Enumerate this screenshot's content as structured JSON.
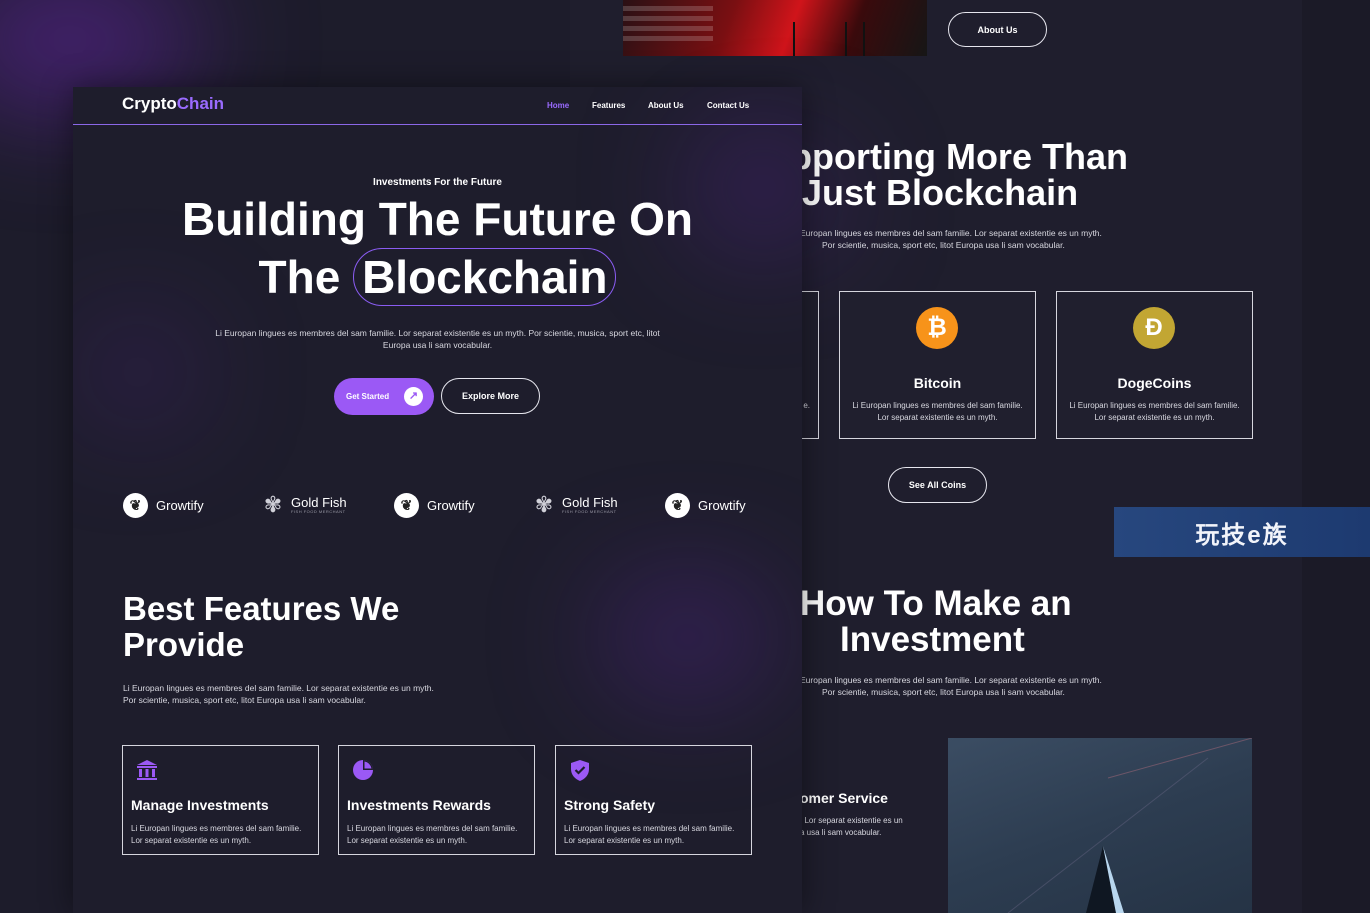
{
  "colors": {
    "accent": "#9b59f5",
    "background": "#1e1d2c",
    "bitcoin": "#f7931a",
    "dogecoin": "#c2a633"
  },
  "right_page": {
    "about_button": "About Us",
    "supporting": {
      "title_line1": "pporting More Than",
      "title_line2": "Just Blockchain",
      "para_line1": "Europan lingues es membres del sam familie. Lor separat existentie es un myth.",
      "para_line2": "Por scientie, musica, sport etc, litot Europa usa li sam vocabular."
    },
    "partial_card_text": "e.",
    "coins": [
      {
        "icon": "bitcoin-icon",
        "symbol": "₿",
        "name": "Bitcoin",
        "desc_line1": "Li Europan lingues es membres del sam familie.",
        "desc_line2": "Lor separat existentie es un myth."
      },
      {
        "icon": "dogecoin-icon",
        "symbol": "Ð",
        "name": "DogeCoins",
        "desc_line1": "Li Europan lingues es membres del sam familie.",
        "desc_line2": "Lor separat existentie es un myth."
      }
    ],
    "see_all_coins": "See All Coins",
    "howto": {
      "title_line1": "How To Make an",
      "title_line2": "Investment",
      "para_line1": "Europan lingues es membres del sam familie. Lor separat existentie es un myth.",
      "para_line2": "Por scientie, musica, sport etc, litot Europa usa li sam vocabular."
    },
    "service": {
      "title": "omer Service",
      "line1": ". Lor separat existentie es un",
      "line2": "a usa li sam vocabular."
    }
  },
  "watermark": "玩技e族",
  "main": {
    "logo": {
      "part1": "Crypto",
      "part2": "Chain"
    },
    "nav": [
      "Home",
      "Features",
      "About Us",
      "Contact Us"
    ],
    "hero": {
      "eyebrow": "Investments For the Future",
      "line1": "Building The Future On",
      "line2_a": "The",
      "line2_b": "Blockchain",
      "para": "Li Europan lingues es membres del sam familie. Lor separat existentie es un myth. Por scientie, musica, sport etc, litot Europa usa li sam vocabular.",
      "primary_button": "Get Started",
      "secondary_button": "Explore More"
    },
    "brands": [
      {
        "name": "Growtify",
        "icon": "growtify-logo-icon"
      },
      {
        "name": "Gold Fish",
        "icon": "goldfish-logo-icon",
        "tagline": "FISH FOOD MERCHANT"
      },
      {
        "name": "Growtify",
        "icon": "growtify-logo-icon"
      },
      {
        "name": "Gold Fish",
        "icon": "goldfish-logo-icon",
        "tagline": "FISH FOOD MERCHANT"
      },
      {
        "name": "Growtify",
        "icon": "growtify-logo-icon"
      }
    ],
    "features": {
      "title": "Best Features We Provide",
      "para_line1": "Li Europan lingues es membres del sam familie. Lor separat existentie es un myth.",
      "para_line2": "Por scientie, musica, sport etc, litot Europa usa li sam vocabular.",
      "cards": [
        {
          "icon": "bank-icon",
          "title": "Manage Investments",
          "desc_line1": "Li Europan lingues es membres del sam familie.",
          "desc_line2": "Lor separat existentie es un myth."
        },
        {
          "icon": "pie-chart-icon",
          "title": "Investments Rewards",
          "desc_line1": "Li Europan lingues es membres del sam familie.",
          "desc_line2": "Lor separat existentie es un myth."
        },
        {
          "icon": "shield-check-icon",
          "title": "Strong Safety",
          "desc_line1": "Li Europan lingues es membres del sam familie.",
          "desc_line2": "Lor separat existentie es un myth."
        }
      ]
    }
  }
}
